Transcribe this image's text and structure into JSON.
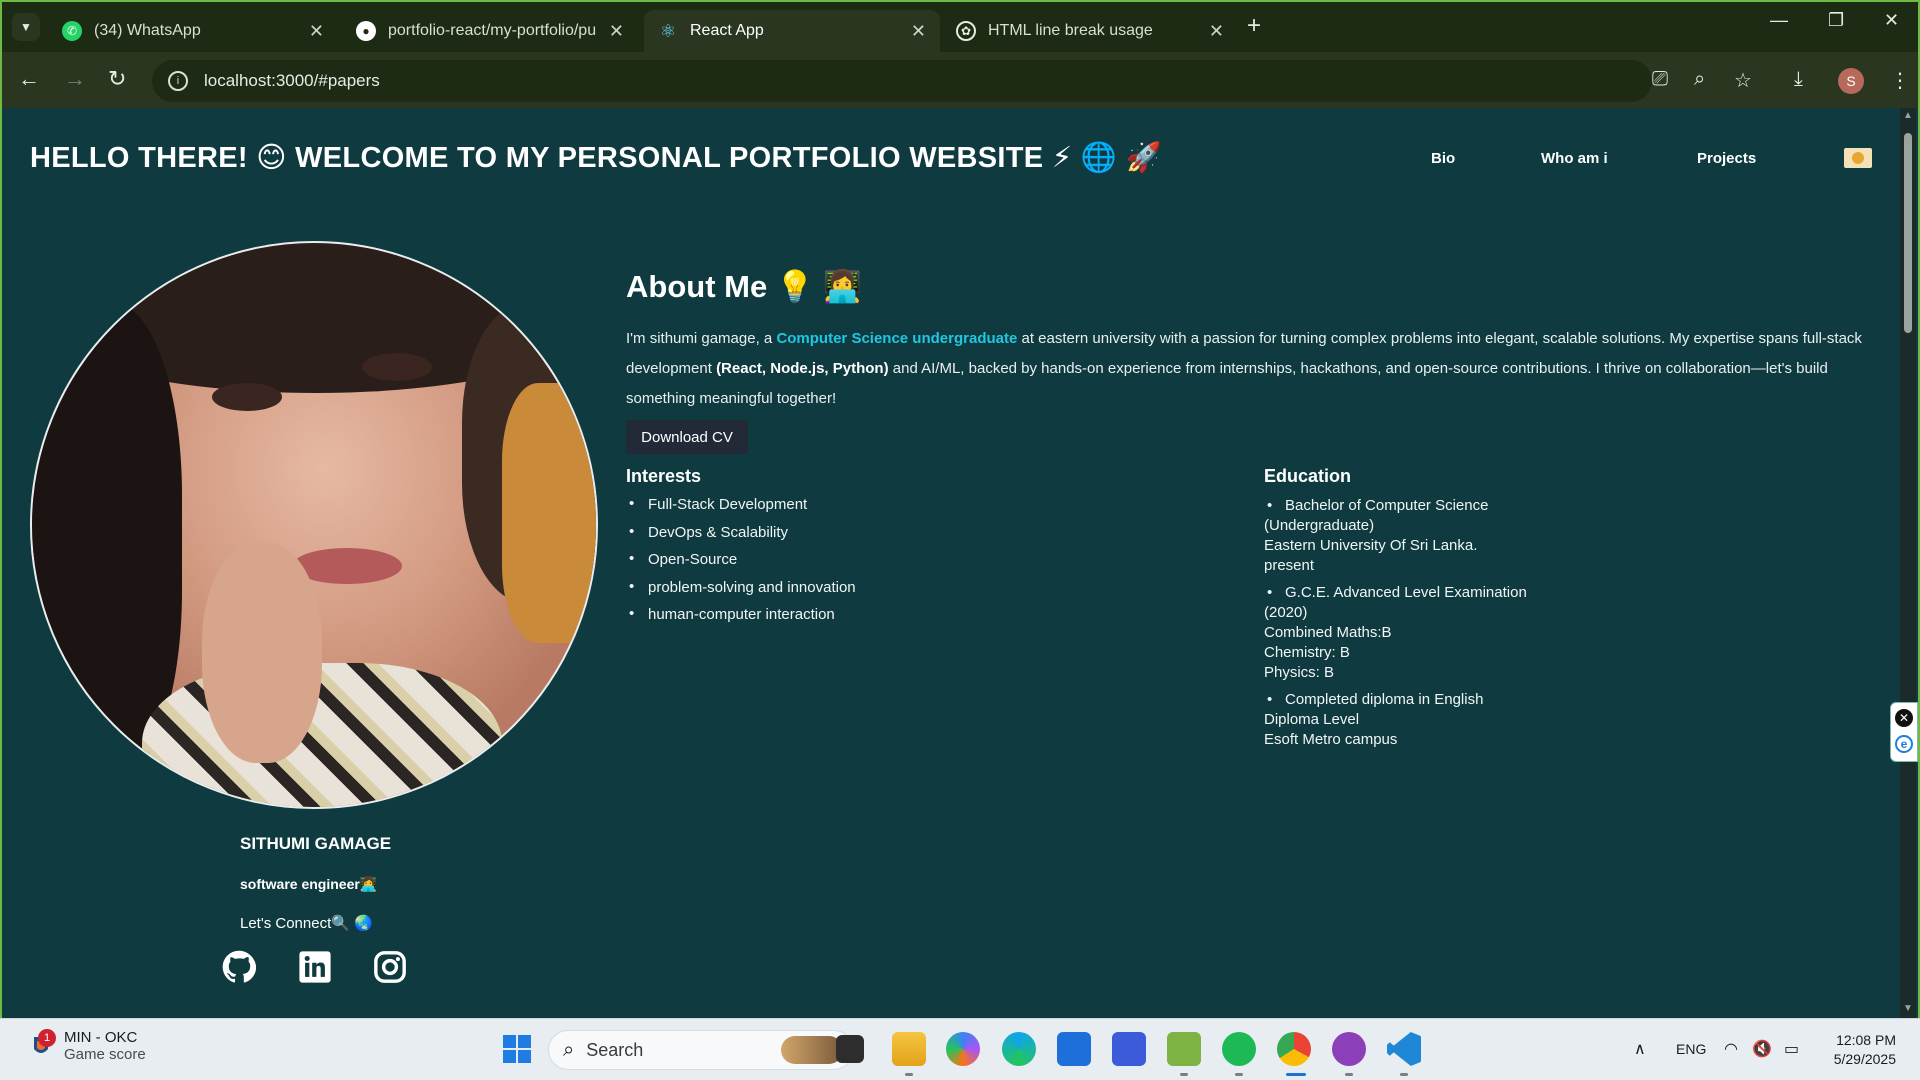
{
  "browser": {
    "tabs": [
      {
        "title": "(34) WhatsApp",
        "icon": "whatsapp-icon",
        "color": "#25d366"
      },
      {
        "title": "portfolio-react/my-portfolio/pu",
        "icon": "github-icon",
        "color": "#ffffff"
      },
      {
        "title": "React App",
        "icon": "react-icon",
        "color": "#61dafb"
      },
      {
        "title": "HTML line break usage",
        "icon": "openai-icon",
        "color": "#ffffff"
      }
    ],
    "url": "localhost:3000/#papers",
    "profile_initial": "S"
  },
  "page": {
    "title": "HELLO THERE! 😊 WELCOME TO MY PERSONAL PORTFOLIO WEBSITE ⚡ 🌐 🚀",
    "nav": {
      "bio": "Bio",
      "who": "Who am i",
      "projects": "Projects"
    },
    "profile": {
      "name": "SITHUMI GAMAGE",
      "role": "software engineer👩‍💻",
      "connect": "Let's Connect🔍 🌏"
    },
    "about": {
      "heading": "About Me 💡 👩‍💻",
      "text_1": "I'm sithumi gamage, a ",
      "text_highlight": "Computer Science undergraduate",
      "text_2": " at eastern university with a passion for turning complex problems into elegant, scalable solutions. My expertise spans full-stack development ",
      "text_bold": "(React, Node.js, Python)",
      "text_3": " and AI/ML, backed by hands-on experience from internships, hackathons, and open-source contributions. I thrive on collaboration—let's build something meaningful together!",
      "download_cv": "Download CV"
    },
    "interests": {
      "heading": "Interests",
      "items": [
        "Full-Stack Development",
        "DevOps & Scalability",
        "Open-Source",
        "problem-solving and innovation",
        "human-computer interaction"
      ]
    },
    "education": {
      "heading": "Education",
      "items": [
        [
          "Bachelor of Computer Science",
          "(Undergraduate)",
          "Eastern University Of Sri Lanka.",
          "present"
        ],
        [
          "G.C.E. Advanced Level Examination",
          "(2020)",
          "Combined Maths:B",
          "Chemistry: B",
          "Physics: B"
        ],
        [
          "Completed diploma in English",
          "Diploma Level",
          "Esoft Metro campus"
        ]
      ]
    },
    "colors": {
      "background": "#0f3b40",
      "accent": "#22c6e0",
      "button": "#222a38"
    }
  },
  "taskbar": {
    "widget_badge": "1",
    "widget_title": "MIN - OKC",
    "widget_subtitle": "Game score",
    "search_label": "Search",
    "language": "ENG",
    "time": "12:08 PM",
    "date": "5/29/2025"
  }
}
